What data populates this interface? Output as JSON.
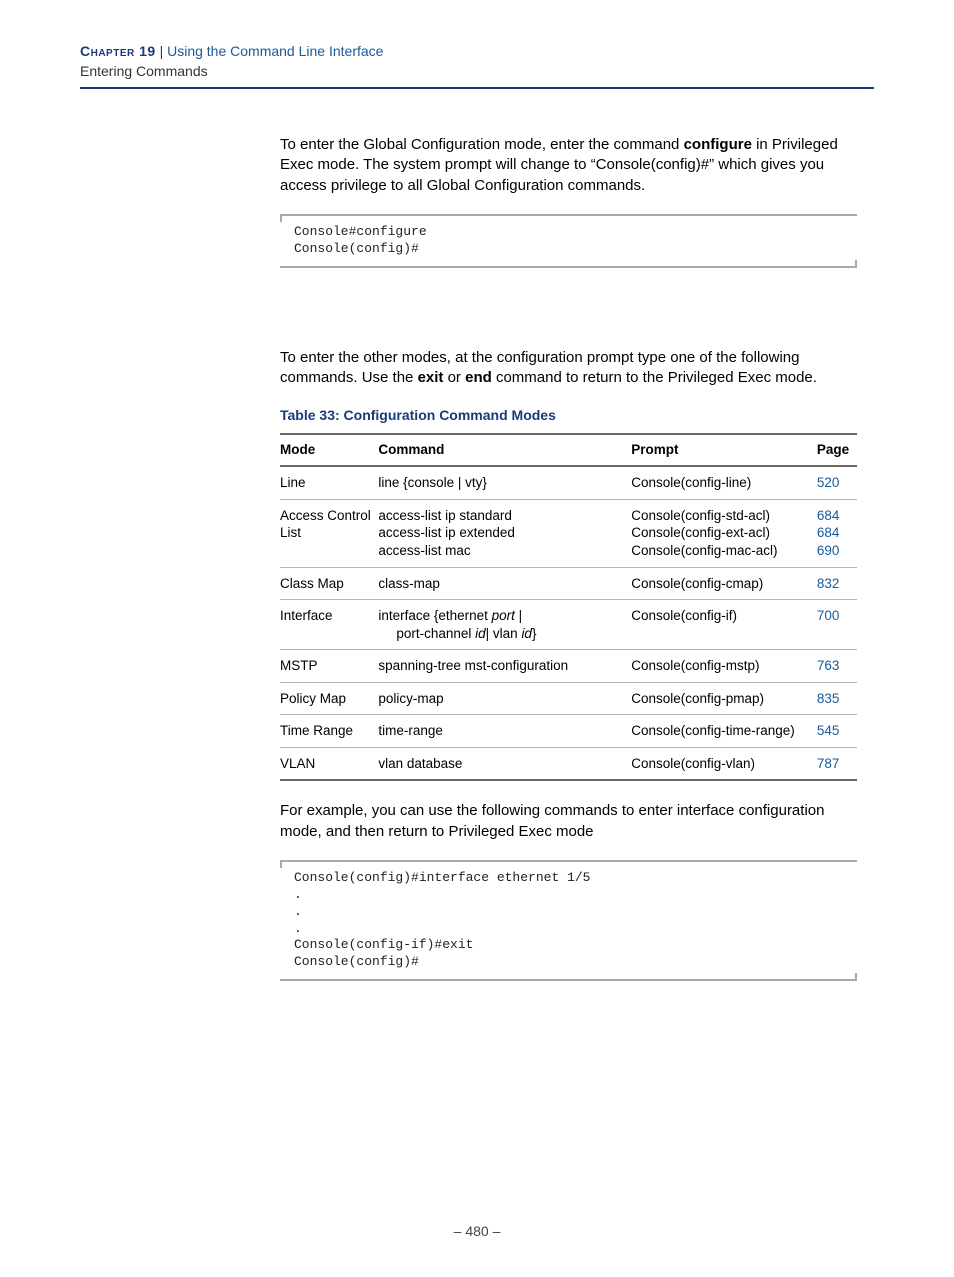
{
  "header": {
    "chapter_label": "Chapter 19",
    "separator": "  |  ",
    "title": "Using the Command Line Interface",
    "subtitle": "Entering Commands"
  },
  "para1_pre": "To enter the Global Configuration mode, enter the command ",
  "para1_bold": "configure",
  "para1_post": " in Privileged Exec mode. The system prompt will change to “Console(config)#” which gives you access privilege to all Global Configuration commands.",
  "code1": "Console#configure\nConsole(config)#",
  "para2_pre": "To enter the other modes, at the configuration prompt type one of the following commands. Use the ",
  "para2_b1": "exit",
  "para2_mid": " or ",
  "para2_b2": "end",
  "para2_post": " command to return to the Privileged Exec mode.",
  "table": {
    "caption": "Table 33: Configuration Command Modes",
    "headers": {
      "mode": "Mode",
      "command": "Command",
      "prompt": "Prompt",
      "page": "Page"
    },
    "rows": [
      {
        "mode": "Line",
        "command_html": "line {console | vty}",
        "prompt": "Console(config-line)",
        "page": "520"
      },
      {
        "mode": "Access Control List",
        "command_html": "access-list ip standard<br>access-list ip extended<br>access-list mac",
        "prompt": "Console(config-std-acl)<br>Console(config-ext-acl)<br>Console(config-mac-acl)",
        "page": "684<br>684<br>690"
      },
      {
        "mode": "Class Map",
        "command_html": "class-map",
        "prompt": "Console(config-cmap)",
        "page": "832"
      },
      {
        "mode": "Interface",
        "command_html": "interface {ethernet <span class=\"italic\">port</span> |<span class=\"sub-indent\">port-channel <span class=\"italic\">id</span>| vlan <span class=\"italic\">id</span>}</span>",
        "prompt": "Console(config-if)",
        "page": "700"
      },
      {
        "mode": "MSTP",
        "command_html": "spanning-tree mst-configuration",
        "prompt": "Console(config-mstp)",
        "page": "763"
      },
      {
        "mode": "Policy Map",
        "command_html": "policy-map",
        "prompt": "Console(config-pmap)",
        "page": "835"
      },
      {
        "mode": "Time Range",
        "command_html": "time-range",
        "prompt": "Console(config-time-range)",
        "page": "545"
      },
      {
        "mode": "VLAN",
        "command_html": "vlan database",
        "prompt": "Console(config-vlan)",
        "page": "787"
      }
    ]
  },
  "para3": "For example, you can use the following commands to enter interface configuration mode, and then return to Privileged Exec mode",
  "code2": "Console(config)#interface ethernet 1/5\n.\n.\n.\nConsole(config-if)#exit\nConsole(config)#",
  "page_num": "–  480  –"
}
